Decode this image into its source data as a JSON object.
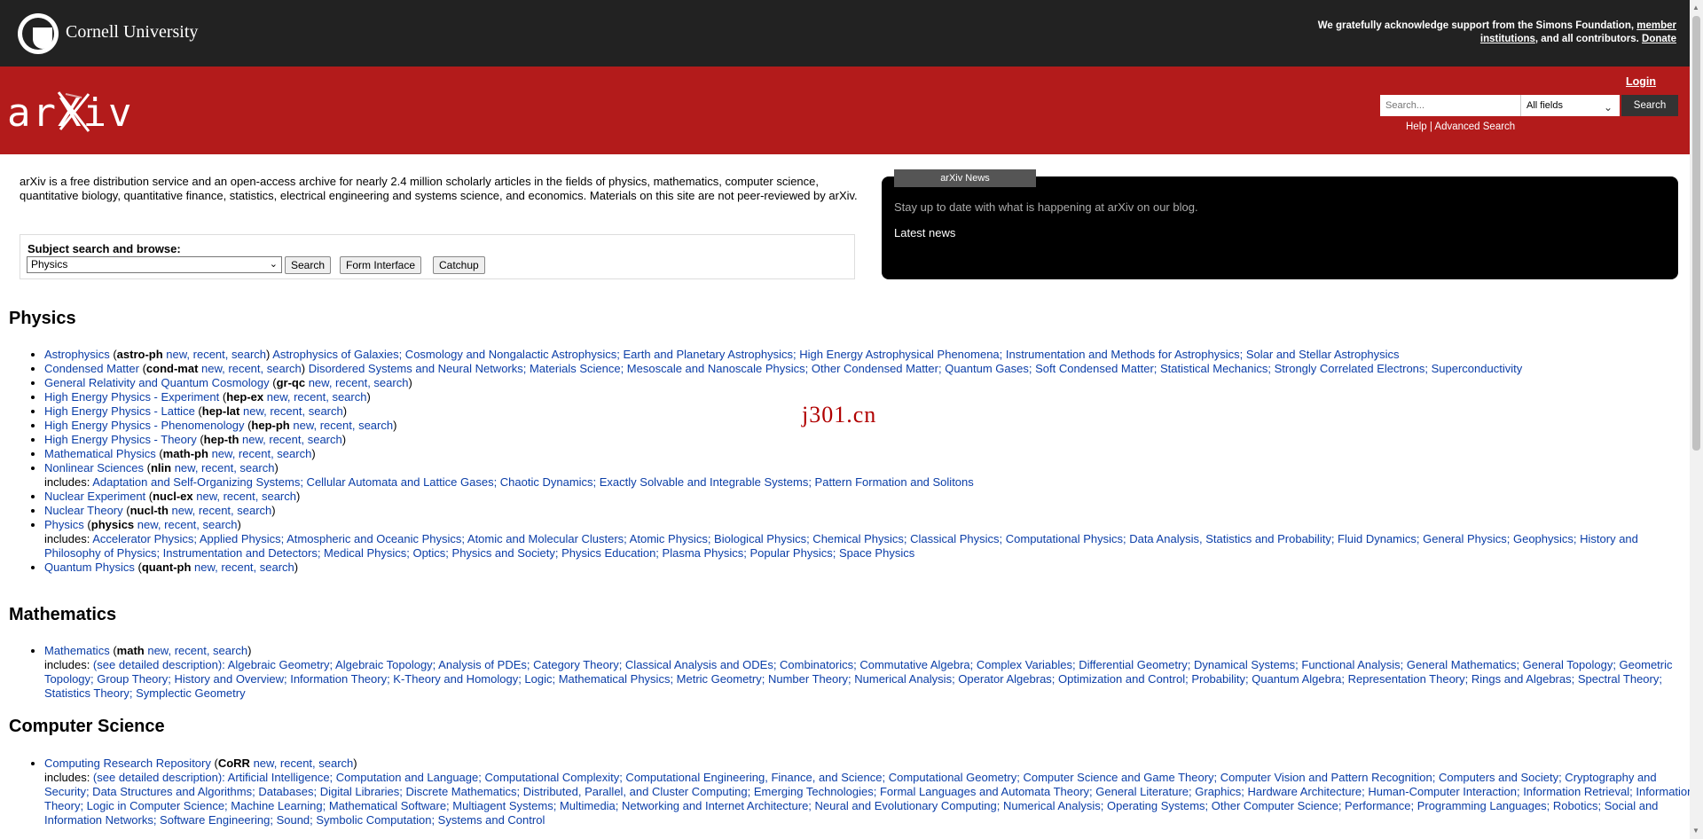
{
  "header": {
    "institution": "Cornell University",
    "support_prefix": "We gratefully acknowledge support from the Simons Foundation, ",
    "member_link": "member institutions",
    "support_suffix": ", and all contributors. ",
    "donate_link": "Donate",
    "logo_text": "arXiv",
    "login": "Login",
    "search_placeholder": "Search...",
    "field_select": "All fields",
    "search_button": "Search",
    "help": "Help",
    "separator": " | ",
    "advanced": "Advanced Search"
  },
  "intro": {
    "text": "arXiv is a free distribution service and an open-access archive for nearly 2.4 million scholarly articles in the fields of physics, mathematics, computer science, quantitative biology, quantitative finance, statistics, electrical engineering and systems science, and economics. Materials on this site are not peer-reviewed by arXiv."
  },
  "subject_search": {
    "label": "Subject search and browse:",
    "selected": "Physics",
    "search": "Search",
    "form": "Form Interface",
    "catchup": "Catchup"
  },
  "news": {
    "tab": "arXiv News",
    "text": "Stay up to date with what is happening at arXiv on our blog.",
    "latest": "Latest news"
  },
  "watermark": "j301.cn",
  "sections": [
    {
      "title": "Physics",
      "items": [
        {
          "name": "Astrophysics",
          "code": "astro-ph",
          "links": "new, recent, search",
          "after": " Astrophysics of Galaxies; Cosmology and Nongalactic Astrophysics; Earth and Planetary Astrophysics; High Energy Astrophysical Phenomena; Instrumentation and Methods for Astrophysics; Solar and Stellar Astrophysics",
          "includes": ""
        },
        {
          "name": "Condensed Matter",
          "code": "cond-mat",
          "links": "new, recent, search",
          "after": " Disordered Systems and Neural Networks; Materials Science; Mesoscale and Nanoscale Physics; Other Condensed Matter; Quantum Gases; Soft Condensed Matter; Statistical Mechanics; Strongly Correlated Electrons; Superconductivity",
          "includes": ""
        },
        {
          "name": "General Relativity and Quantum Cosmology",
          "code": "gr-qc",
          "links": "new, recent, search",
          "after": "",
          "includes": ""
        },
        {
          "name": "High Energy Physics - Experiment",
          "code": "hep-ex",
          "links": "new, recent, search",
          "after": "",
          "includes": ""
        },
        {
          "name": "High Energy Physics - Lattice",
          "code": "hep-lat",
          "links": "new, recent, search",
          "after": "",
          "includes": ""
        },
        {
          "name": "High Energy Physics - Phenomenology",
          "code": "hep-ph",
          "links": "new, recent, search",
          "after": "",
          "includes": ""
        },
        {
          "name": "High Energy Physics - Theory",
          "code": "hep-th",
          "links": "new, recent, search",
          "after": "",
          "includes": ""
        },
        {
          "name": "Mathematical Physics",
          "code": "math-ph",
          "links": "new, recent, search",
          "after": "",
          "includes": ""
        },
        {
          "name": "Nonlinear Sciences",
          "code": "nlin",
          "links": "new, recent, search",
          "after": "",
          "includes": "Adaptation and Self-Organizing Systems; Cellular Automata and Lattice Gases; Chaotic Dynamics; Exactly Solvable and Integrable Systems; Pattern Formation and Solitons"
        },
        {
          "name": "Nuclear Experiment",
          "code": "nucl-ex",
          "links": "new, recent, search",
          "after": "",
          "includes": ""
        },
        {
          "name": "Nuclear Theory",
          "code": "nucl-th",
          "links": "new, recent, search",
          "after": "",
          "includes": ""
        },
        {
          "name": "Physics",
          "code": "physics",
          "links": "new, recent, search",
          "after": "",
          "includes": "Accelerator Physics; Applied Physics; Atmospheric and Oceanic Physics; Atomic and Molecular Clusters; Atomic Physics; Biological Physics; Chemical Physics; Classical Physics; Computational Physics; Data Analysis, Statistics and Probability; Fluid Dynamics; General Physics; Geophysics; History and Philosophy of Physics; Instrumentation and Detectors; Medical Physics; Optics; Physics and Society; Physics Education; Plasma Physics; Popular Physics; Space Physics"
        },
        {
          "name": "Quantum Physics",
          "code": "quant-ph",
          "links": "new, recent, search",
          "after": "",
          "includes": ""
        }
      ]
    },
    {
      "title": "Mathematics",
      "items": [
        {
          "name": "Mathematics",
          "code": "math",
          "links": "new, recent, search",
          "after": "",
          "includes": "(see detailed description): Algebraic Geometry; Algebraic Topology; Analysis of PDEs; Category Theory; Classical Analysis and ODEs; Combinatorics; Commutative Algebra; Complex Variables; Differential Geometry; Dynamical Systems; Functional Analysis; General Mathematics; General Topology; Geometric Topology; Group Theory; History and Overview; Information Theory; K-Theory and Homology; Logic; Mathematical Physics; Metric Geometry; Number Theory; Numerical Analysis; Operator Algebras; Optimization and Control; Probability; Quantum Algebra; Representation Theory; Rings and Algebras; Spectral Theory; Statistics Theory; Symplectic Geometry"
        }
      ]
    },
    {
      "title": "Computer Science",
      "items": [
        {
          "name": "Computing Research Repository",
          "code": "CoRR",
          "links": "new, recent, search",
          "after": "",
          "includes": "(see detailed description): Artificial Intelligence; Computation and Language; Computational Complexity; Computational Engineering, Finance, and Science; Computational Geometry; Computer Science and Game Theory; Computer Vision and Pattern Recognition; Computers and Society; Cryptography and Security; Data Structures and Algorithms; Databases; Digital Libraries; Discrete Mathematics; Distributed, Parallel, and Cluster Computing; Emerging Technologies; Formal Languages and Automata Theory; General Literature; Graphics; Hardware Architecture; Human-Computer Interaction; Information Retrieval; Information Theory; Logic in Computer Science; Machine Learning; Mathematical Software; Multiagent Systems; Multimedia; Networking and Internet Architecture; Neural and Evolutionary Computing; Numerical Analysis; Operating Systems; Other Computer Science; Performance; Programming Languages; Robotics; Social and Information Networks; Software Engineering; Sound; Symbolic Computation; Systems and Control"
        }
      ]
    }
  ]
}
